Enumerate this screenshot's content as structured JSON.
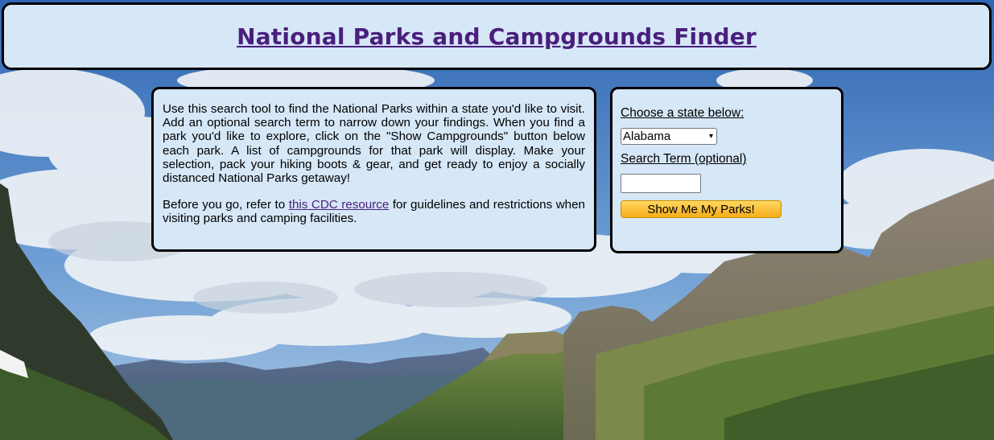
{
  "header": {
    "title": "National Parks and Campgrounds Finder"
  },
  "info": {
    "paragraph1": "Use this search tool to find the National Parks within a state you'd like to visit. Add an optional search term to narrow down your findings. When you find a park you'd like to explore, click on the \"Show Campgrounds\" button below each park. A list of campgrounds for that park will display. Make your selection, pack your hiking boots & gear, and get ready to enjoy a socially distanced National Parks getaway!",
    "paragraph2_before": "Before you go, refer to ",
    "cdc_link": "this CDC resource",
    "paragraph2_after": " for guidelines and restrictions when visiting parks and camping facilities."
  },
  "search": {
    "state_label": "Choose a state below:",
    "state_selected": "Alabama",
    "term_label": "Search Term (optional)",
    "term_value": "",
    "submit_label": "Show Me My Parks!"
  },
  "colors": {
    "panel_bg": "#d6e7f7",
    "title_color": "#4a1f7c",
    "button_top": "#ffd860",
    "button_bottom": "#f5ac1a"
  }
}
